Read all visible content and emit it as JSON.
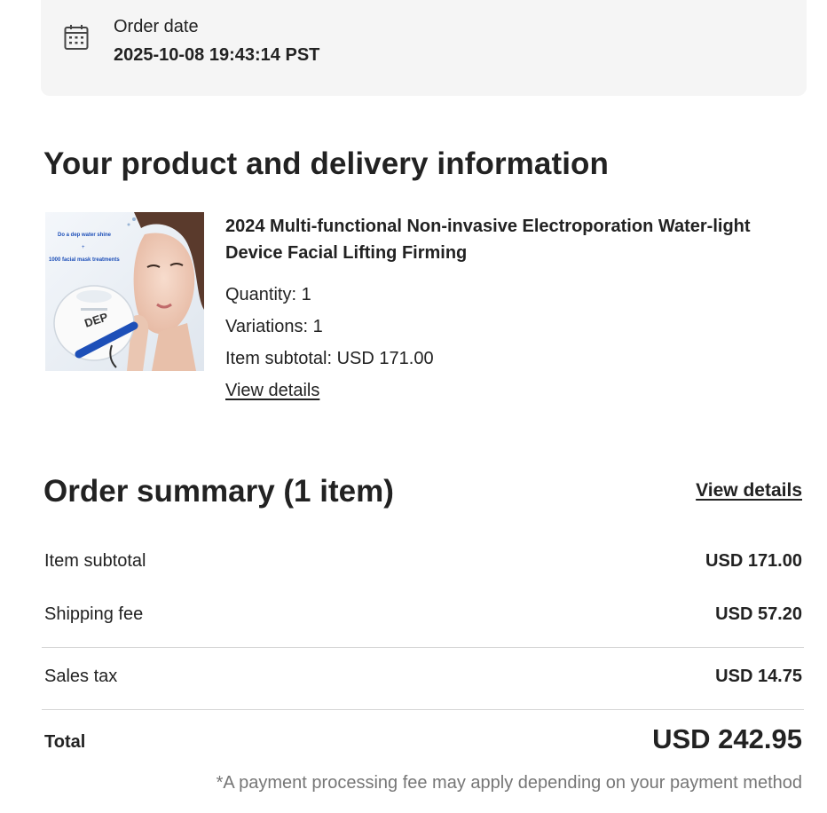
{
  "order_date": {
    "icon": "calendar-icon",
    "label": "Order date",
    "value": "2025-10-08 19:43:14 PST"
  },
  "product_section": {
    "title": "Your product and delivery information",
    "item": {
      "image_text_line1": "Do a dep water shine",
      "image_text_plus": "+",
      "image_text_line2": "1000 facial mask treatments",
      "image_brand": "DEP",
      "title": "2024 Multi-functional Non-invasive Electroporation Water-light Device Facial Lifting Firming",
      "quantity": "Quantity: 1",
      "variations": "Variations: 1",
      "subtotal": "Item subtotal: USD 171.00",
      "view_details": "View details"
    }
  },
  "summary": {
    "title": "Order summary (1 item)",
    "view_details": "View details",
    "rows": [
      {
        "label": "Item subtotal",
        "value": "USD 171.00"
      },
      {
        "label": "Shipping fee",
        "value": "USD 57.20"
      },
      {
        "label": "Sales tax",
        "value": "USD 14.75"
      }
    ],
    "total_label": "Total",
    "total_value": "USD 242.95",
    "footnote": "*A payment processing fee may apply depending on your payment method"
  }
}
